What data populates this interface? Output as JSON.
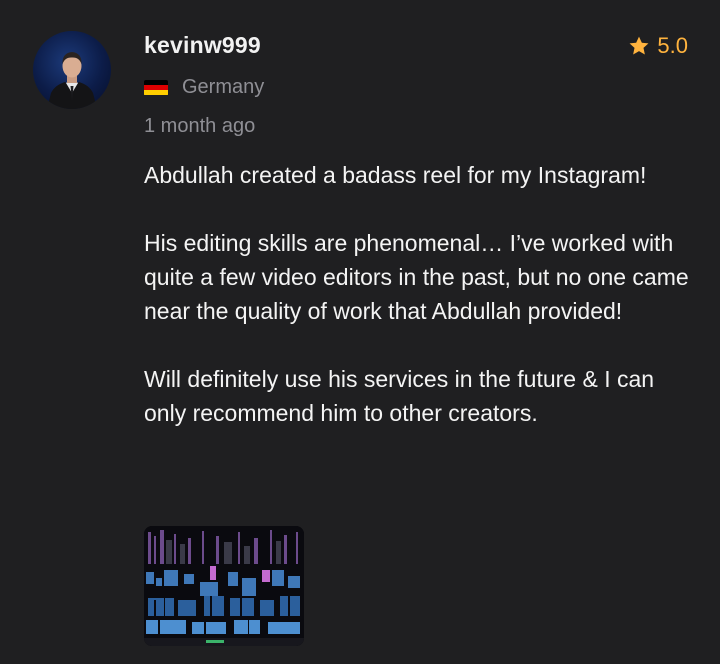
{
  "review": {
    "username": "kevinw999",
    "rating": "5.0",
    "country": "Germany",
    "flag_colors": [
      "#000000",
      "#dd0000",
      "#ffce00"
    ],
    "time_ago": "1 month ago",
    "paragraphs": [
      "Abdullah created a badass reel for my Instagram!",
      "His editing skills are phenomenal… I’ve worked with quite a few video editors in the past, but no one came near the quality of work that Abdullah provided!",
      "Will definitely use his services in the future & I can only recommend him to other creators."
    ],
    "avatar_icon": "user-avatar",
    "star_icon": "star-icon",
    "thumbnail_icon": "video-timeline-thumbnail"
  },
  "colors": {
    "background": "#1f1f21",
    "text": "#f4f4f4",
    "muted": "#8f8f95",
    "star": "#ffb33e"
  }
}
